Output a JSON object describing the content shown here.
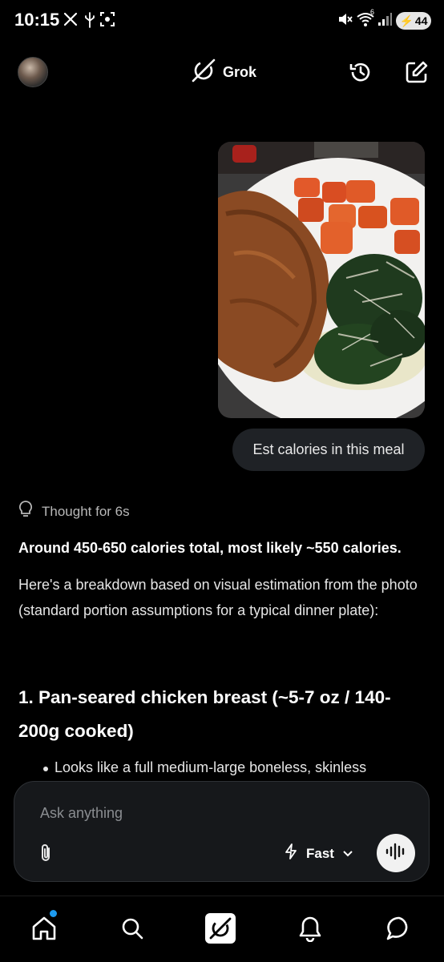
{
  "status_bar": {
    "time": "10:15",
    "battery": "44",
    "signal_label": "6"
  },
  "header": {
    "title": "Grok",
    "icons": [
      "avatar",
      "grok-logo-icon",
      "history-icon",
      "compose-icon"
    ]
  },
  "chat": {
    "user_message": "Est calories in this meal",
    "thought_label": "Thought for 6s",
    "answer_summary": "Around 450-650 calories total, most likely ~550 calories.",
    "answer_body": "Here's a breakdown based on visual estimation from the photo (standard portion assumptions for a typical dinner plate):",
    "section_heading": "1. Pan-seared chicken breast (~5-7 oz / 140-200g cooked)",
    "bullet_partial": "Looks like a full medium-large boneless, skinless"
  },
  "composer": {
    "placeholder": "Ask anything",
    "mode_label": "Fast"
  },
  "bottom_nav": {
    "items": [
      "home-icon",
      "search-icon",
      "grok-icon",
      "notifications-icon",
      "messages-icon"
    ]
  },
  "colors": {
    "background": "#000000",
    "bubble": "#1f2226",
    "composer": "#16181b",
    "notification_dot": "#1d9bf0"
  }
}
